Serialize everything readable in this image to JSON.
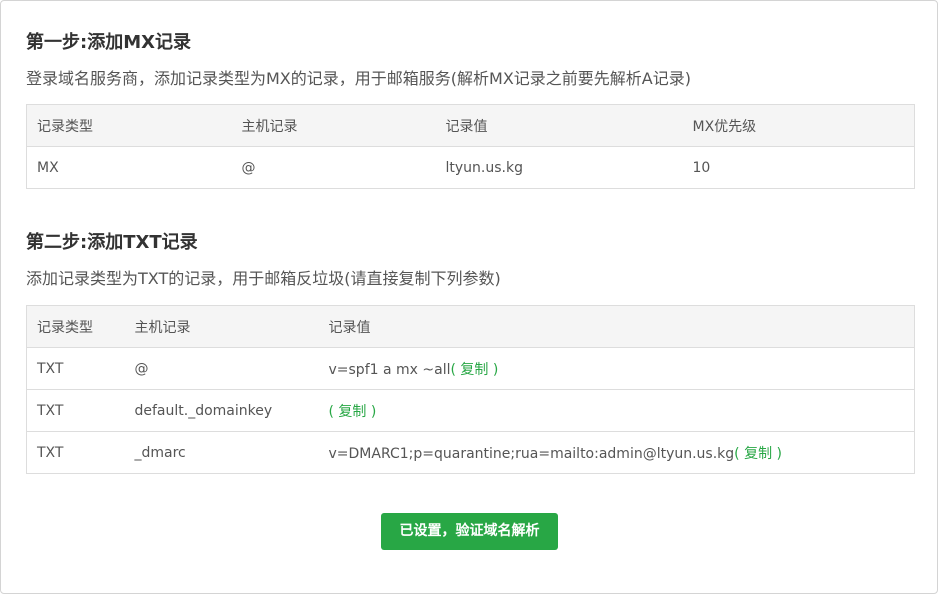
{
  "step1": {
    "title": "第一步:添加MX记录",
    "description": "登录域名服务商，添加记录类型为MX的记录，用于邮箱服务(解析MX记录之前要先解析A记录)",
    "headers": [
      "记录类型",
      "主机记录",
      "记录值",
      "MX优先级"
    ],
    "rows": [
      {
        "type": "MX",
        "host": "@",
        "value": "ltyun.us.kg",
        "priority": "10"
      }
    ]
  },
  "step2": {
    "title": "第二步:添加TXT记录",
    "description": "添加记录类型为TXT的记录，用于邮箱反垃圾(请直接复制下列参数)",
    "headers": [
      "记录类型",
      "主机记录",
      "记录值"
    ],
    "rows": [
      {
        "type": "TXT",
        "host": "@",
        "value": "v=spf1 a mx ~all",
        "copy": "( 复制 )"
      },
      {
        "type": "TXT",
        "host": "default._domainkey",
        "value": "",
        "copy": "( 复制 )"
      },
      {
        "type": "TXT",
        "host": "_dmarc",
        "value": "v=DMARC1;p=quarantine;rua=mailto:admin@ltyun.us.kg",
        "copy": "( 复制 )"
      }
    ]
  },
  "confirm_button": "已设置，验证域名解析",
  "colors": {
    "accent": "#28a745",
    "header_bg": "#f5f5f5",
    "border": "#dddddd"
  }
}
